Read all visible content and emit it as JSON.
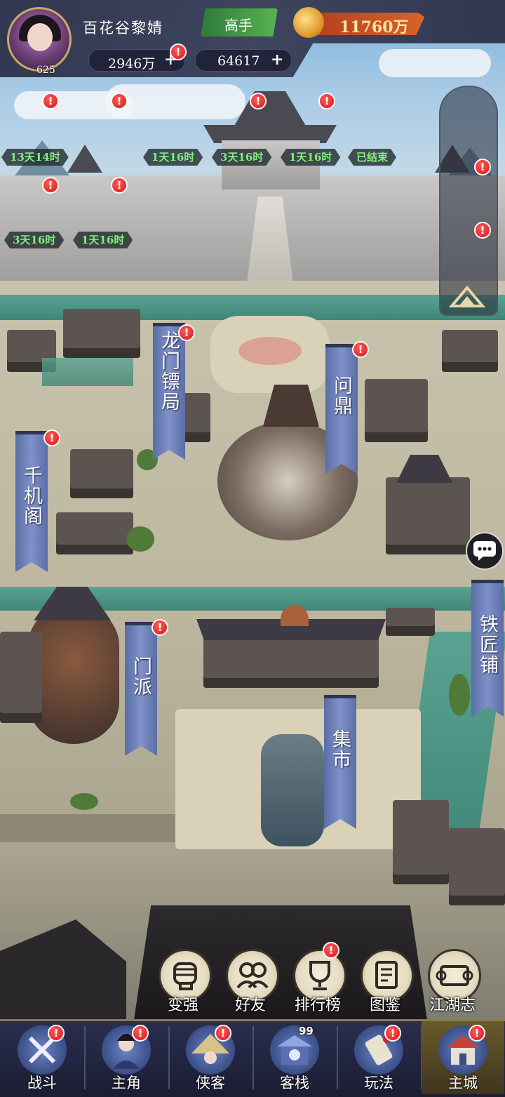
{
  "player": {
    "name": "百花谷黎婧",
    "level": "625",
    "rank": "高手"
  },
  "currency": {
    "gold": "11760万",
    "resource_1": "2946万",
    "resource_2": "64617",
    "plus": "+"
  },
  "alert_mark": "!",
  "timers": [
    "13天14时",
    "1天16时",
    "3天16时",
    "1天16时",
    "已结束",
    "3天16时",
    "1天16时"
  ],
  "buildings": {
    "longmen": "龙门镖局",
    "wending": "问鼎",
    "qianji": "千机阁",
    "menpai": "门派",
    "tiejiang": "铁匠铺",
    "jishi": "集市"
  },
  "functions": [
    {
      "label": "变强",
      "icon": "fist-icon"
    },
    {
      "label": "好友",
      "icon": "friends-icon"
    },
    {
      "label": "排行榜",
      "icon": "trophy-icon"
    },
    {
      "label": "图鉴",
      "icon": "book-icon"
    },
    {
      "label": "江湖志",
      "icon": "scroll-icon"
    }
  ],
  "nav": [
    {
      "label": "战斗",
      "icon": "crossed-swords-icon"
    },
    {
      "label": "主角",
      "icon": "hero-icon"
    },
    {
      "label": "侠客",
      "icon": "swordsman-hat-icon"
    },
    {
      "label": "客栈",
      "icon": "inn-icon",
      "badge": "99"
    },
    {
      "label": "玩法",
      "icon": "scroll-map-icon"
    },
    {
      "label": "主城",
      "icon": "city-icon",
      "active": true
    }
  ],
  "colors": {
    "accent_gold": "#c9a96a",
    "timer_green": "#7ef07a",
    "alert_red": "#d91616",
    "banner_blue": "#6f82b9"
  }
}
